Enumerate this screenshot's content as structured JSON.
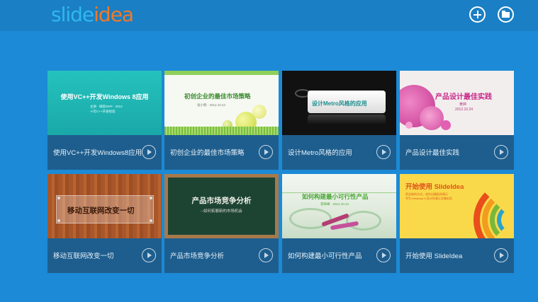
{
  "app": {
    "logo_part1": "slide",
    "logo_part2": "idea"
  },
  "toolbar": {
    "new_icon": "plus-circle-icon",
    "open_icon": "folder-circle-icon"
  },
  "templates": [
    {
      "label": "使用VC++开发Windows8应用",
      "thumb_title": "使用VC++开发Windows 8应用",
      "thumb_sub1": "主讲 · 微软MVP · 2012",
      "thumb_sub2": "十年C++开发经验"
    },
    {
      "label": "初创企业的最佳市场策略",
      "thumb_title": "初创企业的最佳市场策略",
      "thumb_sub": "张小明 · 2012.10.24"
    },
    {
      "label": "设计Metro风格的应用",
      "thumb_title": "设计Metro风格的应用"
    },
    {
      "label": "产品设计最佳实践",
      "thumb_title": "产品设计最佳实践",
      "thumb_sub1": "黄婷",
      "thumb_sub2": "2012.10.24"
    },
    {
      "label": "移动互联网改变一切",
      "thumb_title": "移动互联网改变一切"
    },
    {
      "label": "产品市场竞争分析",
      "thumb_title": "产品市场竞争分析",
      "thumb_sub": "--如何拓展新的市场机会"
    },
    {
      "label": "如何构建最小可行性产品",
      "thumb_title": "如何构建最小可行性产品",
      "thumb_sub": "李梓峰 · 2012.10.24"
    },
    {
      "label": "开始使用 SlideIdea",
      "thumb_title": "开始使用 SlideIdea",
      "thumb_sub1": "用全新的方式，创作出精彩的演示",
      "thumb_sub2": "专为 Windows 8 设计的演示文稿应用"
    }
  ],
  "colors": {
    "background": "#1c8ad6",
    "caption": "#1e5e8e",
    "logo_blue": "#2fb8ef",
    "logo_orange": "#ef7a2a"
  }
}
